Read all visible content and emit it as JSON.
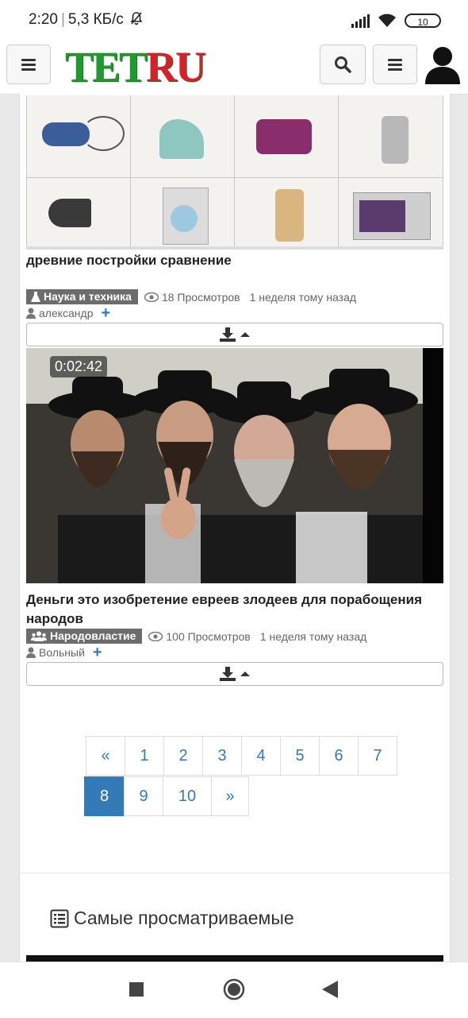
{
  "status_bar": {
    "time": "2:20",
    "net_speed": "5,3 КБ/с",
    "battery": "10"
  },
  "header": {
    "logo": "TETRU",
    "colors": {
      "logo_green": "#1e9a2e",
      "logo_red": "#d9202a"
    }
  },
  "posts": [
    {
      "title": "древние постройки сравнение",
      "category": "Наука и техника",
      "views": "18 Просмотров",
      "date": "1 неделя тому назад",
      "author": "александр"
    },
    {
      "duration": "0:02:42",
      "title": "Деньги это изобретение евреев злодеев для порабощения народов",
      "category": "Народовластие",
      "views": "100 Просмотров",
      "date": "1 неделя тому назад",
      "author": "Вольный"
    }
  ],
  "pagination": {
    "row1": [
      "«",
      "1",
      "2",
      "3",
      "4",
      "5",
      "6",
      "7"
    ],
    "row2": [
      "8",
      "9",
      "10",
      "»"
    ],
    "active": "8"
  },
  "section": {
    "title": "Самые просматриваемые"
  },
  "colors": {
    "accent": "#337ab7",
    "category_bg": "#6c6c6c"
  }
}
